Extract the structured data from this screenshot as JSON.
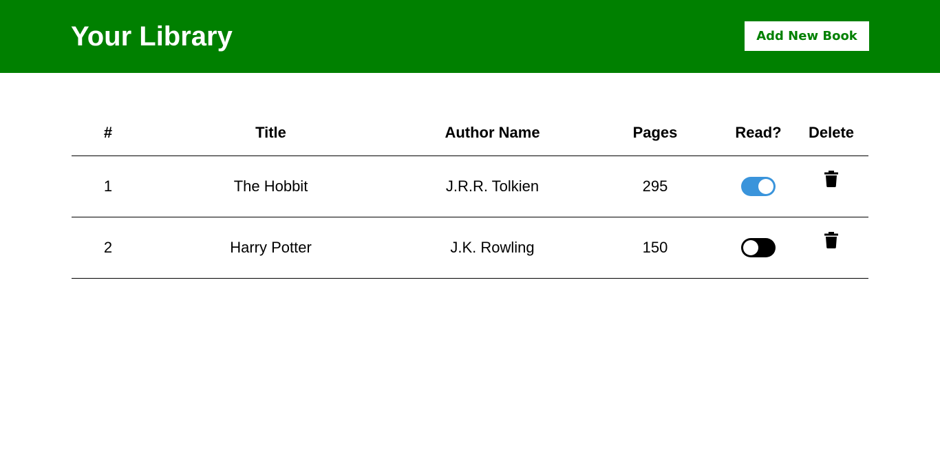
{
  "header": {
    "title": "Your Library",
    "add_button_label": "Add New Book"
  },
  "table": {
    "columns": [
      "#",
      "Title",
      "Author Name",
      "Pages",
      "Read?",
      "Delete"
    ],
    "rows": [
      {
        "num": "1",
        "title": "The Hobbit",
        "author": "J.R.R. Tolkien",
        "pages": "295",
        "read": true
      },
      {
        "num": "2",
        "title": "Harry Potter",
        "author": "J.K. Rowling",
        "pages": "150",
        "read": false
      }
    ]
  },
  "icons": {
    "delete": "trash-icon"
  },
  "colors": {
    "header_bg": "#008000",
    "header_text": "#ffffff",
    "toggle_on": "#3a94db",
    "toggle_off": "#000000"
  }
}
